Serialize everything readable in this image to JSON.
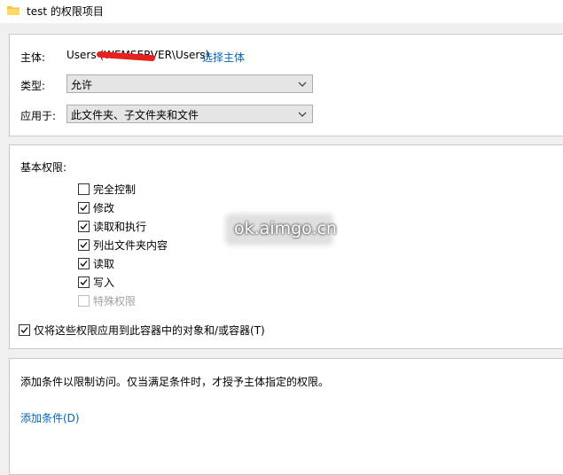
{
  "window": {
    "title": "test 的权限项目",
    "folder_icon": "folder-icon"
  },
  "principal_section": {
    "principal_label": "主体:",
    "principal_value": "Users (WEMSERVER\\Users)",
    "select_principal_link": "选择主体",
    "type_label": "类型:",
    "type_value": "允许",
    "applies_label": "应用于:",
    "applies_value": "此文件夹、子文件夹和文件"
  },
  "permissions": {
    "heading": "基本权限:",
    "items": [
      {
        "label": "完全控制",
        "checked": false,
        "disabled": false
      },
      {
        "label": "修改",
        "checked": true,
        "disabled": false
      },
      {
        "label": "读取和执行",
        "checked": true,
        "disabled": false
      },
      {
        "label": "列出文件夹内容",
        "checked": true,
        "disabled": false
      },
      {
        "label": "读取",
        "checked": true,
        "disabled": false
      },
      {
        "label": "写入",
        "checked": true,
        "disabled": false
      },
      {
        "label": "特殊权限",
        "checked": false,
        "disabled": true
      }
    ],
    "apply_only_label": "仅将这些权限应用到此容器中的对象和/或容器(T)",
    "apply_only_checked": true
  },
  "conditions": {
    "description": "添加条件以限制访问。仅当满足条件时，才授予主体指定的权限。",
    "add_condition_link": "添加条件(D)"
  },
  "watermark": {
    "text": "ok.aimgo.cn"
  }
}
